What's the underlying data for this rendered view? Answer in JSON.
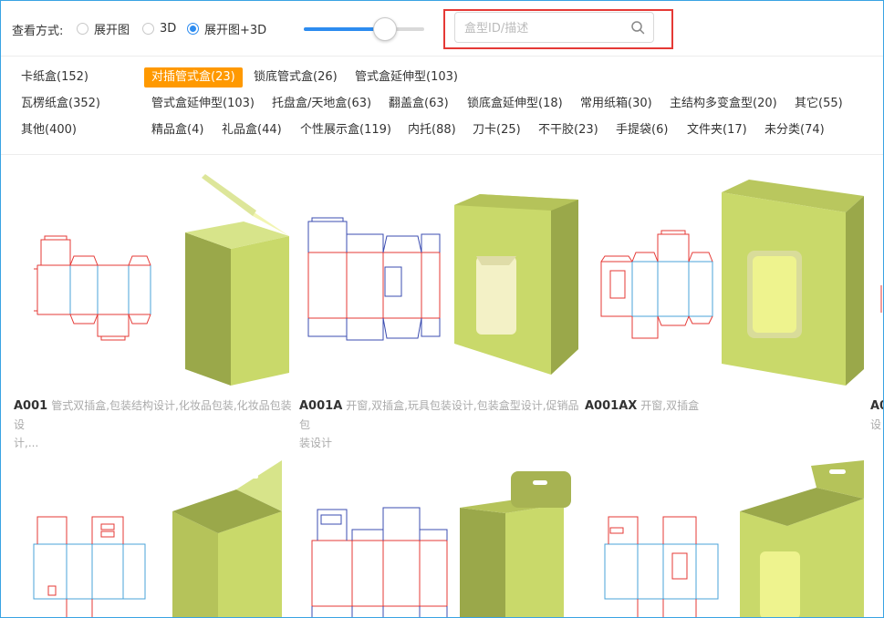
{
  "toolbar": {
    "view_label": "查看方式:",
    "view_modes": [
      {
        "label": "展开图",
        "selected": false
      },
      {
        "label": "3D",
        "selected": false
      },
      {
        "label": "展开图+3D",
        "selected": true
      }
    ],
    "zoom_slider_value": 0.67,
    "search_placeholder": "盒型ID/描述",
    "accent_color": "#2d8cf0",
    "highlight_color": "#e53935"
  },
  "categories": {
    "primary": [
      {
        "label": "卡纸盒(152)"
      },
      {
        "label": "瓦楞纸盒(352)"
      },
      {
        "label": "其他(400)"
      }
    ],
    "row1": [
      {
        "label": "对插管式盒(23)",
        "active": true
      },
      {
        "label": "锁底管式盒(26)"
      },
      {
        "label": "管式盒延伸型(103)"
      }
    ],
    "row2": [
      {
        "label": "管式盒延伸型(103)"
      },
      {
        "label": "托盘盒/天地盒(63)"
      },
      {
        "label": "翻盖盒(63)"
      },
      {
        "label": "锁底盒延伸型(18)"
      },
      {
        "label": "常用纸箱(30)"
      },
      {
        "label": "主结构多变盒型(20)"
      },
      {
        "label": "其它(55)"
      }
    ],
    "row3": [
      {
        "label": "精品盒(4)"
      },
      {
        "label": "礼品盒(44)"
      },
      {
        "label": "个性展示盒(119)"
      },
      {
        "label": "内托(88)"
      },
      {
        "label": "刀卡(25)"
      },
      {
        "label": "不干胶(23)"
      },
      {
        "label": "手提袋(6)"
      },
      {
        "label": "文件夹(17)"
      },
      {
        "label": "未分类(74)"
      }
    ],
    "active_color": "#ff9900"
  },
  "cards": [
    {
      "id": "A001",
      "desc_line1": "管式双插盒,包装结构设计,化妆品包装,化妆品包装设",
      "desc_line2": "计,..."
    },
    {
      "id": "A001A",
      "desc_line1": "开窗,双插盒,玩具包装设计,包装盒型设计,促销品包",
      "desc_line2": "装设计"
    },
    {
      "id": "A001AX",
      "desc_line1": "开窗,双插盒",
      "desc_line2": ""
    },
    {
      "id": "A0",
      "desc_line1": "",
      "desc_line2": "设"
    }
  ],
  "icons": [
    "search-icon",
    "box-dieline",
    "box-3d"
  ],
  "box_color": "#c9d96a"
}
